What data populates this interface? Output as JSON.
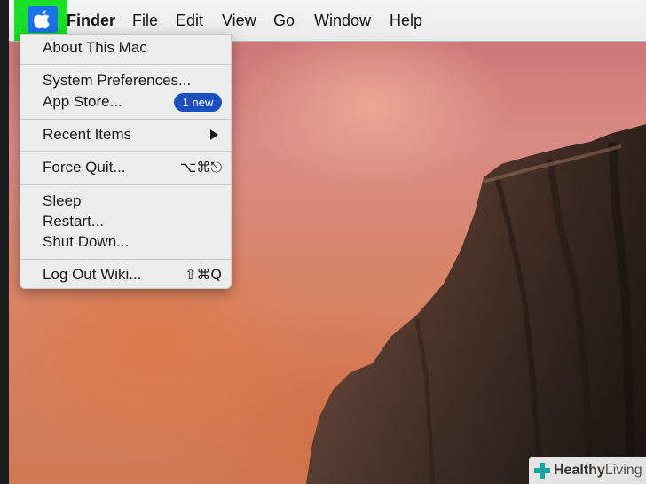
{
  "menubar": {
    "apple_icon": "apple-icon",
    "items": [
      "Finder",
      "File",
      "Edit",
      "View",
      "Go",
      "Window",
      "Help"
    ]
  },
  "apple_menu": {
    "about": "About This Mac",
    "system_prefs": "System Preferences...",
    "app_store": "App Store...",
    "app_store_badge": "1 new",
    "recent_items": "Recent Items",
    "force_quit": "Force Quit...",
    "force_quit_shortcut": "⌥⌘⎋",
    "sleep": "Sleep",
    "restart": "Restart...",
    "shut_down": "Shut Down...",
    "log_out": "Log Out Wiki...",
    "log_out_shortcut": "⇧⌘Q"
  },
  "watermark": {
    "brand_bold": "Healthy",
    "brand_light": "Living"
  },
  "colors": {
    "highlight": "#19e024",
    "apple_selected": "#1a73e8",
    "badge": "#1d4fbf"
  }
}
